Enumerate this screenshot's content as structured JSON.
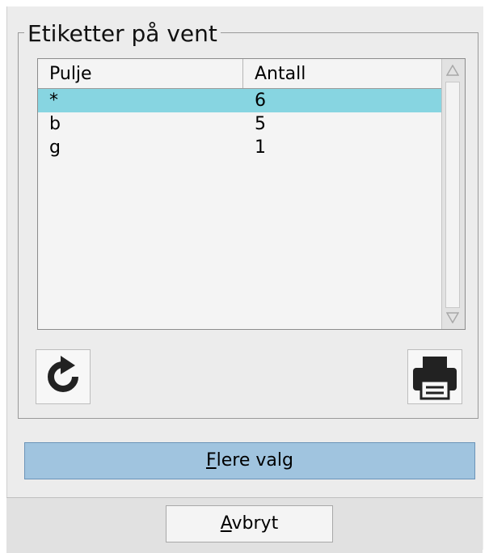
{
  "group": {
    "title": "Etiketter på vent"
  },
  "table": {
    "columns": [
      "Pulje",
      "Antall"
    ],
    "rows": [
      {
        "pulje": "*",
        "antall": "6",
        "selected": true
      },
      {
        "pulje": "b",
        "antall": "5",
        "selected": false
      },
      {
        "pulje": "g",
        "antall": "1",
        "selected": false
      }
    ]
  },
  "icons": {
    "refresh": "refresh-icon",
    "print": "printer-icon"
  },
  "buttons": {
    "more_options": {
      "mnemonic": "F",
      "rest": "lere valg"
    },
    "cancel": {
      "mnemonic": "A",
      "rest": "vbryt"
    }
  },
  "colors": {
    "selection": "#87d5e1",
    "primary_button": "#a0c4df"
  }
}
